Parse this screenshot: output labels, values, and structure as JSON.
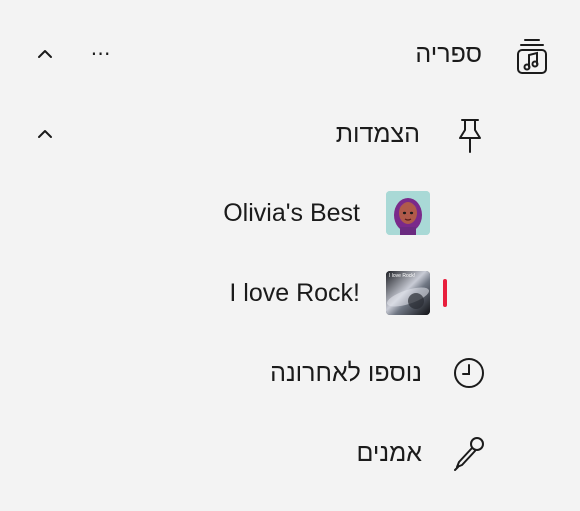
{
  "library": {
    "label": "ספריה",
    "icon": "library-music-icon"
  },
  "pinned": {
    "label": "הצמדות",
    "icon": "pin-icon"
  },
  "pinned_items": [
    {
      "label": "Olivia's Best",
      "thumb": "avatar-art"
    },
    {
      "label": "I love Rock!",
      "thumb": "rock-art",
      "thumb_caption": "I love Rock!"
    }
  ],
  "recent": {
    "label": "נוספו לאחרונה",
    "icon": "clock-icon"
  },
  "artists": {
    "label": "אמנים",
    "icon": "microphone-icon"
  },
  "colors": {
    "background": "#f3f3f3",
    "text": "#1b1b1b",
    "accent": "#e81e3c"
  }
}
